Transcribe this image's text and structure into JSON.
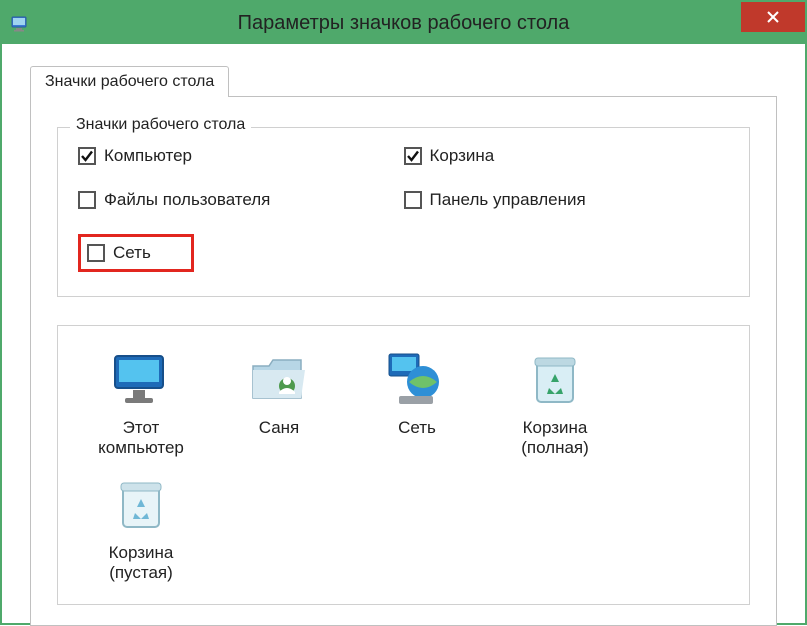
{
  "window": {
    "title": "Параметры значков рабочего стола"
  },
  "tab": {
    "label": "Значки рабочего стола"
  },
  "group": {
    "legend": "Значки рабочего стола",
    "checks": {
      "computer": {
        "label": "Компьютер",
        "checked": true
      },
      "recycle": {
        "label": "Корзина",
        "checked": true
      },
      "userfiles": {
        "label": "Файлы пользователя",
        "checked": false
      },
      "cpanel": {
        "label": "Панель управления",
        "checked": false
      },
      "network": {
        "label": "Сеть",
        "checked": false,
        "highlighted": true
      }
    }
  },
  "icons": {
    "this_pc": {
      "label": "Этот\nкомпьютер"
    },
    "user": {
      "label": "Саня"
    },
    "network": {
      "label": "Сеть"
    },
    "recycle_full": {
      "label": "Корзина\n(полная)"
    },
    "recycle_empty": {
      "label": "Корзина\n(пустая)"
    }
  }
}
